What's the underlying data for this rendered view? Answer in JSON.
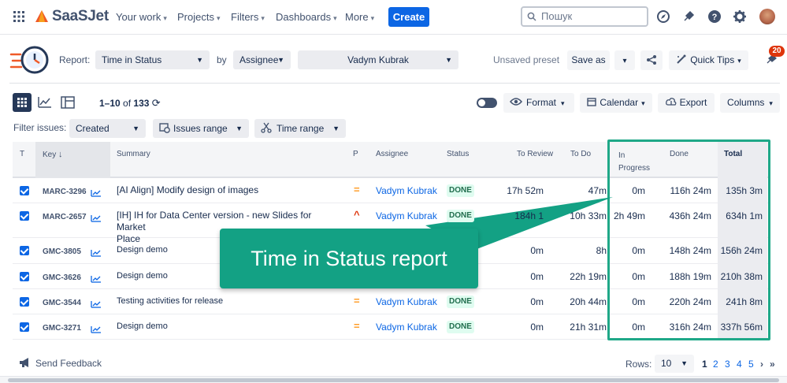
{
  "nav": {
    "brand": "SaaSJet",
    "items": [
      "Your work",
      "Projects",
      "Filters",
      "Dashboards",
      "More"
    ],
    "create_label": "Create",
    "search_placeholder": "Пошук"
  },
  "report_bar": {
    "report_label": "Report:",
    "report_value": "Time in Status",
    "by_label": "by",
    "group_value": "Assignee",
    "user_value": "Vadym Kubrak",
    "unsaved": "Unsaved preset",
    "save_as": "Save as",
    "quick_tips": "Quick Tips",
    "notif_count": "20"
  },
  "toolbar": {
    "pagination_range": "1–10",
    "pagination_of": "of",
    "pagination_total": "133",
    "format": "Format",
    "calendar": "Calendar",
    "export": "Export",
    "columns": "Columns"
  },
  "filters": {
    "label": "Filter issues:",
    "created": "Created",
    "issues_range": "Issues range",
    "time_range": "Time range"
  },
  "table": {
    "headers": {
      "t": "T",
      "key": "Key",
      "summary": "Summary",
      "p": "P",
      "assignee": "Assignee",
      "status": "Status",
      "to_review": "To Review",
      "to_do": "To Do",
      "in_progress_1": "In",
      "in_progress_2": "Progress",
      "done": "Done",
      "total": "Total"
    },
    "rows": [
      {
        "key": "MARC-3296",
        "summary": "[AI Align] Modify design of images",
        "summary2": "",
        "prio": "=",
        "assignee": "Vadym Kubrak",
        "status": "DONE",
        "to_review": "17h 52m",
        "to_do": "47m",
        "in_progress": "0m",
        "done": "116h 24m",
        "total": "135h 3m"
      },
      {
        "key": "MARC-2657",
        "summary": "[IH] IH for Data Center version - new Slides for Market",
        "summary2": "Place",
        "prio": "^",
        "assignee": "Vadym Kubrak",
        "status": "DONE",
        "to_review": "184h 1",
        "to_do": "10h 33m",
        "in_progress": "2h 49m",
        "done": "436h 24m",
        "total": "634h 1m"
      },
      {
        "key": "GMC-3805",
        "summary": "Design demo",
        "summary2": "",
        "prio": "",
        "assignee": "",
        "status": "",
        "to_review": "0m",
        "to_do": "8h",
        "in_progress": "0m",
        "done": "148h 24m",
        "total": "156h 24m"
      },
      {
        "key": "GMC-3626",
        "summary": "Design demo",
        "summary2": "",
        "prio": "",
        "assignee": "",
        "status": "",
        "to_review": "0m",
        "to_do": "22h 19m",
        "in_progress": "0m",
        "done": "188h 19m",
        "total": "210h 38m"
      },
      {
        "key": "GMC-3544",
        "summary": "Testing activities for release",
        "summary2": "",
        "prio": "=",
        "assignee": "Vadym Kubrak",
        "status": "DONE",
        "to_review": "0m",
        "to_do": "20h 44m",
        "in_progress": "0m",
        "done": "220h 24m",
        "total": "241h 8m"
      },
      {
        "key": "GMC-3271",
        "summary": "Design demo",
        "summary2": "",
        "prio": "=",
        "assignee": "Vadym Kubrak",
        "status": "DONE",
        "to_review": "0m",
        "to_do": "21h 31m",
        "in_progress": "0m",
        "done": "316h 24m",
        "total": "337h 56m"
      }
    ]
  },
  "callout": "Time in Status report",
  "footer": {
    "feedback": "Send Feedback",
    "rows_label": "Rows:",
    "rows_value": "10",
    "pages": [
      "1",
      "2",
      "3",
      "4",
      "5"
    ]
  },
  "colors": {
    "accent": "#0c66e4",
    "highlight": "#1fa888",
    "callout": "#13a184",
    "priority_medium": "#ff991f",
    "priority_high": "#de350b"
  }
}
